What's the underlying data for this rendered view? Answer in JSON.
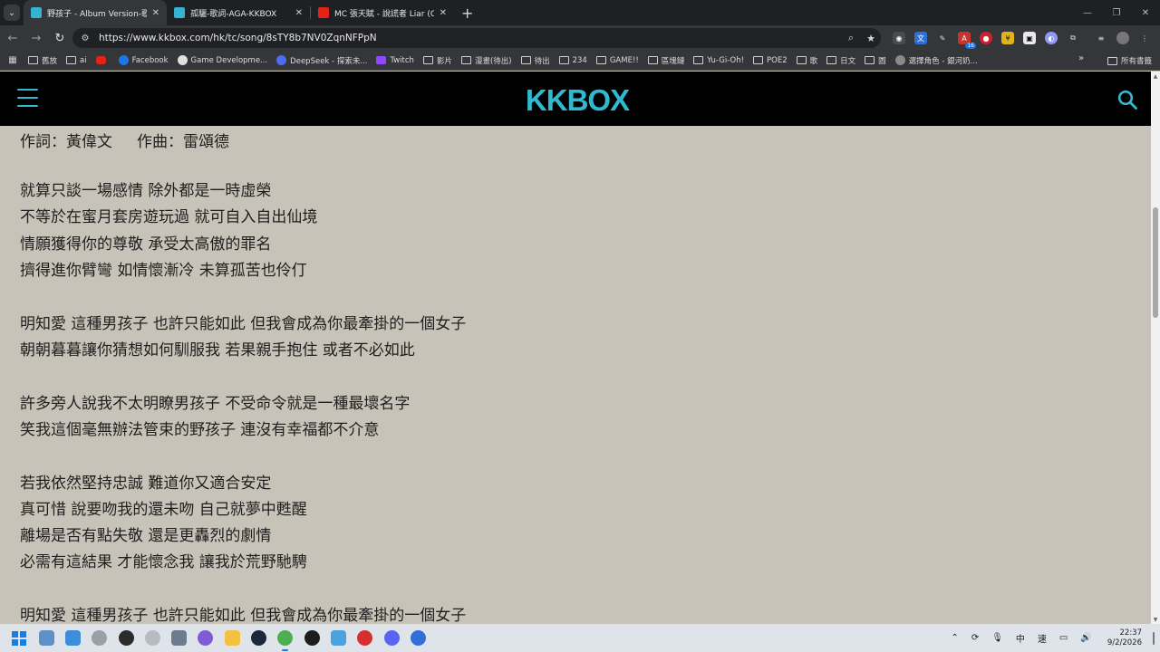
{
  "browser": {
    "tabs": [
      {
        "title": "野孩子 - Album Version-歌詞-",
        "favicon": "kkbox-favicon",
        "active": true
      },
      {
        "title": "孤驪-歌詞-AGA-KKBOX",
        "favicon": "kkbox-favicon",
        "active": false
      },
      {
        "title": "MC 張天賦 - 說謊者 Liar (Offic",
        "favicon": "youtube-favicon",
        "active": false
      }
    ],
    "url": "https://www.kkbox.com/hk/tc/song/8sTY8b7NV0ZqnNFPpN",
    "bookmarks": [
      {
        "label": "舊放",
        "icon": "folder-icon"
      },
      {
        "label": "ai",
        "icon": "folder-icon"
      },
      {
        "label": "",
        "icon": "youtube-icon"
      },
      {
        "label": "Facebook",
        "icon": "facebook-icon"
      },
      {
        "label": "Game Developme...",
        "icon": "github-icon"
      },
      {
        "label": "DeepSeek - 探索未...",
        "icon": "deepseek-icon"
      },
      {
        "label": "Twitch",
        "icon": "twitch-icon"
      },
      {
        "label": "影片",
        "icon": "folder-icon"
      },
      {
        "label": "漫畫(待出)",
        "icon": "folder-icon"
      },
      {
        "label": "待出",
        "icon": "folder-icon"
      },
      {
        "label": "234",
        "icon": "folder-icon"
      },
      {
        "label": "GAME!!",
        "icon": "folder-icon"
      },
      {
        "label": "區塊鏈",
        "icon": "folder-icon"
      },
      {
        "label": "Yu-Gi-Oh!",
        "icon": "folder-icon"
      },
      {
        "label": "POE2",
        "icon": "folder-icon"
      },
      {
        "label": "歌",
        "icon": "folder-icon"
      },
      {
        "label": "日文",
        "icon": "folder-icon"
      },
      {
        "label": "圖",
        "icon": "folder-icon"
      },
      {
        "label": "選擇角色 - 銀河奶...",
        "icon": "game-icon"
      }
    ],
    "all_bookmarks": "所有書籤",
    "extension_badge": "16"
  },
  "site": {
    "logo": "KKBOX",
    "brand_color": "#30b9cf"
  },
  "lyrics": {
    "credits": {
      "lyricist": "作詞：黃偉文",
      "composer": "作曲：雷頌德"
    },
    "lines": [
      "就算只談一場感情 除外都是一時虛榮",
      "不等於在蜜月套房遊玩過 就可自入自出仙境",
      "情願獲得你的尊敬 承受太高傲的罪名",
      "擠得進你臂彎 如情懷漸冷 未算孤苦也伶仃",
      "明知愛 這種男孩子 也許只能如此 但我會成為你最牽掛的一個女子",
      "朝朝暮暮讓你猜想如何馴服我 若果親手抱住 或者不必如此",
      "許多旁人說我不太明瞭男孩子 不受命令就是一種最壞名字",
      "笑我這個毫無辦法管束的野孩子 連沒有幸福都不介意",
      "若我依然堅持忠誠 難道你又適合安定",
      "真可惜 說要吻我的還未吻 自己就夢中甦醒",
      "離場是否有點失敬 還是更轟烈的劇情",
      "必需有這結果 才能懷念我 讓我於荒野馳騁",
      "明知愛 這種男孩子 也許只能如此 但我會成為你最牽掛的一個女子"
    ]
  },
  "taskbar": {
    "ime": "中",
    "ime_mode": "速",
    "time": "22:37",
    "date": "9/2/2026"
  }
}
